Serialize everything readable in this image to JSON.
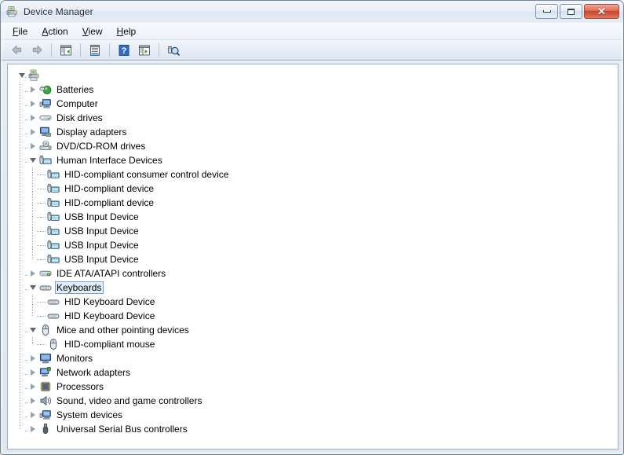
{
  "window": {
    "title": "Device Manager",
    "title_icon": "device-manager-icon",
    "buttons": {
      "minimize": "Minimize",
      "maximize": "Maximize",
      "close": "Close",
      "close_glyph": "✕"
    }
  },
  "menubar": {
    "items": [
      {
        "name": "file",
        "pre": "",
        "accel": "F",
        "post": "ile"
      },
      {
        "name": "action",
        "pre": "",
        "accel": "A",
        "post": "ction"
      },
      {
        "name": "view",
        "pre": "",
        "accel": "V",
        "post": "iew"
      },
      {
        "name": "help",
        "pre": "",
        "accel": "H",
        "post": "elp"
      }
    ]
  },
  "toolbar": {
    "items": [
      {
        "name": "back-button",
        "icon": "back-arrow-icon",
        "type": "button"
      },
      {
        "name": "forward-button",
        "icon": "forward-arrow-icon",
        "type": "button"
      },
      {
        "name": "separator-1",
        "icon": "separator",
        "type": "separator"
      },
      {
        "name": "show-hide-console-tree-button",
        "icon": "console-tree-icon",
        "type": "button"
      },
      {
        "name": "separator-2",
        "icon": "separator",
        "type": "separator"
      },
      {
        "name": "properties-button",
        "icon": "properties-icon",
        "type": "button"
      },
      {
        "name": "separator-3",
        "icon": "separator",
        "type": "separator"
      },
      {
        "name": "help-button",
        "icon": "help-question-icon",
        "type": "button"
      },
      {
        "name": "update-driver-button",
        "icon": "update-driver-icon",
        "type": "button"
      },
      {
        "name": "separator-4",
        "icon": "separator",
        "type": "separator"
      },
      {
        "name": "scan-for-hardware-changes-button",
        "icon": "scan-hardware-icon",
        "type": "button"
      }
    ]
  },
  "tree": {
    "root": {
      "label": "",
      "icon": "computer-root-icon",
      "expanded": true
    },
    "nodes": [
      {
        "label": "Batteries",
        "icon": "battery-icon",
        "level": 1,
        "expanded": false,
        "selected": false
      },
      {
        "label": "Computer",
        "icon": "computer-icon",
        "level": 1,
        "expanded": false,
        "selected": false
      },
      {
        "label": "Disk drives",
        "icon": "disk-drive-icon",
        "level": 1,
        "expanded": false,
        "selected": false
      },
      {
        "label": "Display adapters",
        "icon": "display-adapter-icon",
        "level": 1,
        "expanded": false,
        "selected": false
      },
      {
        "label": "DVD/CD-ROM drives",
        "icon": "dvd-drive-icon",
        "level": 1,
        "expanded": false,
        "selected": false
      },
      {
        "label": "Human Interface Devices",
        "icon": "hid-icon",
        "level": 1,
        "expanded": true,
        "selected": false
      },
      {
        "label": "HID-compliant consumer control device",
        "icon": "hid-icon",
        "level": 2,
        "expanded": null,
        "selected": false
      },
      {
        "label": "HID-compliant device",
        "icon": "hid-icon",
        "level": 2,
        "expanded": null,
        "selected": false
      },
      {
        "label": "HID-compliant device",
        "icon": "hid-icon",
        "level": 2,
        "expanded": null,
        "selected": false
      },
      {
        "label": "USB Input Device",
        "icon": "hid-icon",
        "level": 2,
        "expanded": null,
        "selected": false
      },
      {
        "label": "USB Input Device",
        "icon": "hid-icon",
        "level": 2,
        "expanded": null,
        "selected": false
      },
      {
        "label": "USB Input Device",
        "icon": "hid-icon",
        "level": 2,
        "expanded": null,
        "selected": false
      },
      {
        "label": "USB Input Device",
        "icon": "hid-icon",
        "level": 2,
        "expanded": null,
        "selected": false
      },
      {
        "label": "IDE ATA/ATAPI controllers",
        "icon": "ide-controller-icon",
        "level": 1,
        "expanded": false,
        "selected": false
      },
      {
        "label": "Keyboards",
        "icon": "keyboard-icon",
        "level": 1,
        "expanded": true,
        "selected": true
      },
      {
        "label": "HID Keyboard Device",
        "icon": "keyboard-icon",
        "level": 2,
        "expanded": null,
        "selected": false
      },
      {
        "label": "HID Keyboard Device",
        "icon": "keyboard-icon",
        "level": 2,
        "expanded": null,
        "selected": false
      },
      {
        "label": "Mice and other pointing devices",
        "icon": "mouse-icon",
        "level": 1,
        "expanded": true,
        "selected": false
      },
      {
        "label": "HID-compliant mouse",
        "icon": "mouse-icon",
        "level": 2,
        "expanded": null,
        "selected": false
      },
      {
        "label": "Monitors",
        "icon": "monitor-icon",
        "level": 1,
        "expanded": false,
        "selected": false
      },
      {
        "label": "Network adapters",
        "icon": "network-adapter-icon",
        "level": 1,
        "expanded": false,
        "selected": false
      },
      {
        "label": "Processors",
        "icon": "processor-icon",
        "level": 1,
        "expanded": false,
        "selected": false
      },
      {
        "label": "Sound, video and game controllers",
        "icon": "sound-icon",
        "level": 1,
        "expanded": false,
        "selected": false
      },
      {
        "label": "System devices",
        "icon": "system-device-icon",
        "level": 1,
        "expanded": false,
        "selected": false
      },
      {
        "label": "Universal Serial Bus controllers",
        "icon": "usb-icon",
        "level": 1,
        "expanded": false,
        "selected": false
      }
    ]
  },
  "colors": {
    "selection_fill": "#e2eefb",
    "selection_border": "#7da2ce",
    "window_border": "#6f87a3",
    "close_button": "#c8422c",
    "pane_background": "#ffffff"
  }
}
